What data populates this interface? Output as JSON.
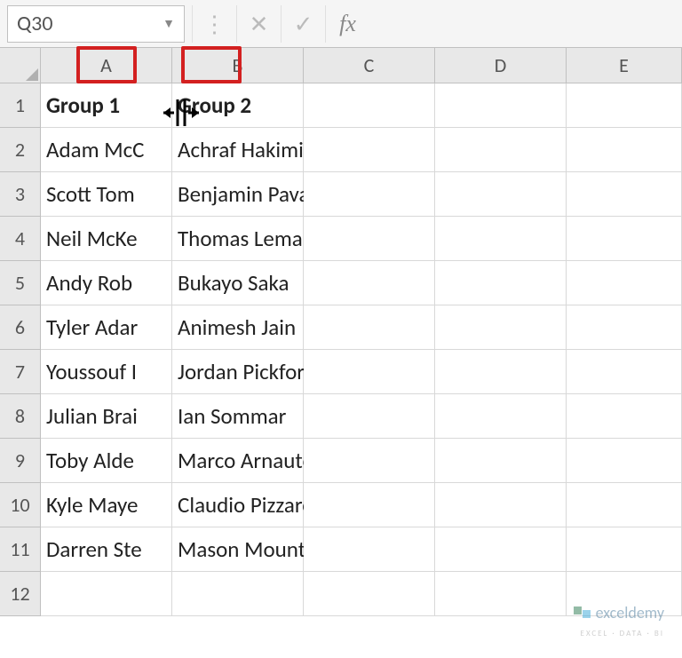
{
  "formula_bar": {
    "name_box": "Q30",
    "fx_label": "fx"
  },
  "columns": [
    "A",
    "B",
    "C",
    "D",
    "E"
  ],
  "rows": [
    1,
    2,
    3,
    4,
    5,
    6,
    7,
    8,
    9,
    10,
    11,
    12
  ],
  "data": {
    "1": {
      "A": "Group 1",
      "B": "Group 2"
    },
    "2": {
      "A": "Adam McC",
      "B": "Achraf Hakimi"
    },
    "3": {
      "A": "Scott Tom",
      "B": "Benjamin Pavard"
    },
    "4": {
      "A": "Neil McKe",
      "B": "Thomas Lemar"
    },
    "5": {
      "A": "Andy Rob",
      "B": "Bukayo Saka"
    },
    "6": {
      "A": "Tyler Adar",
      "B": "Animesh Jain"
    },
    "7": {
      "A": "Youssouf I",
      "B": "Jordan Pickford"
    },
    "8": {
      "A": "Julian Brai",
      "B": "Ian Sommar"
    },
    "9": {
      "A": "Toby Alde",
      "B": "Marco Arnautovic"
    },
    "10": {
      "A": "Kyle Maye",
      "B": "Claudio Pizzaro"
    },
    "11": {
      "A": "Darren Ste",
      "B": "Mason Mount"
    },
    "12": {
      "A": "",
      "B": ""
    }
  },
  "watermark": {
    "main": "exceldemy",
    "sub": "EXCEL · DATA · BI"
  }
}
